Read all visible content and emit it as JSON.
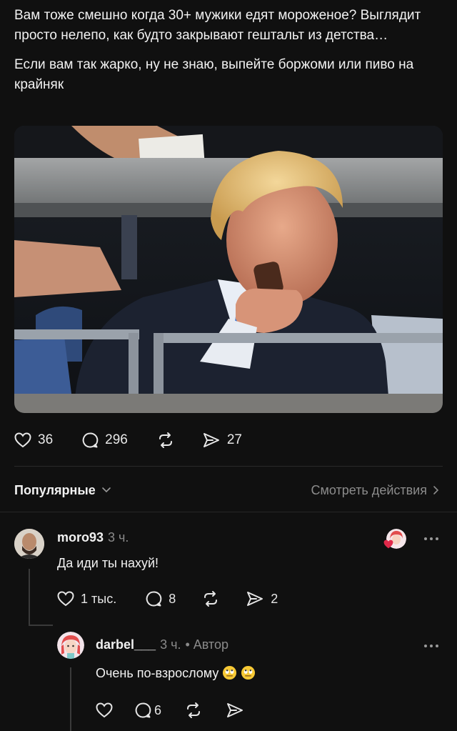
{
  "post": {
    "paragraphs": [
      "Вам тоже смешно когда 30+ мужики едят мороженое? Выглядит просто нелепо, как будто закрывают гештальт из детства…",
      "Если вам так жарко, ну не знаю, выпейте боржоми или пиво на крайняк"
    ],
    "likes": "36",
    "replies": "296",
    "shares": "27"
  },
  "comments_header": {
    "sort_label": "Популярные",
    "view_actions_label": "Смотреть действия"
  },
  "comments": [
    {
      "username": "moro93",
      "time": "3 ч.",
      "text": "Да иди ты нахуй!",
      "likes": "1 тыс.",
      "replies": "8",
      "shares": "2"
    },
    {
      "username": "darbel___",
      "time": "3 ч.",
      "author_badge": "• Автор",
      "text": "Очень по-взрослому",
      "replies": "6"
    }
  ],
  "icons": [
    "heart-icon",
    "comment-icon",
    "repost-icon",
    "send-icon",
    "chevron-down-icon",
    "chevron-right-icon",
    "more-icon",
    "rolling-eyes-emoji"
  ],
  "colors": {
    "background": "#101010",
    "muted_text": "#8c8c8c",
    "like_heart": "#e0294a"
  }
}
